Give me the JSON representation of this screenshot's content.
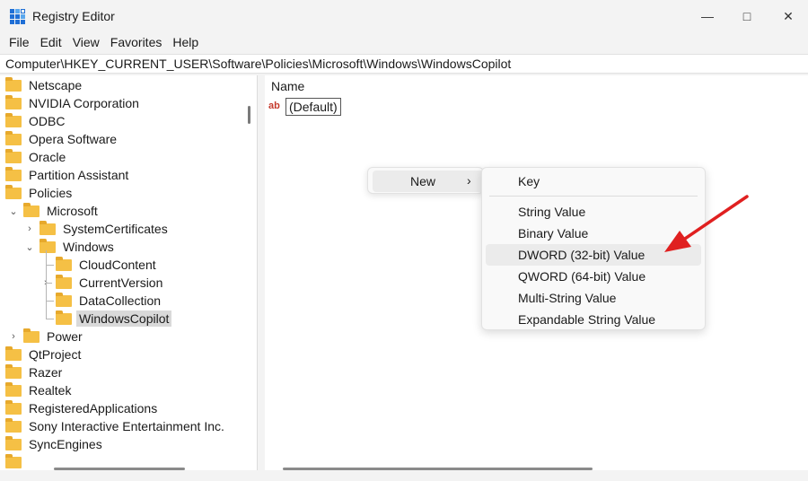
{
  "window": {
    "title": "Registry Editor"
  },
  "menu": [
    "File",
    "Edit",
    "View",
    "Favorites",
    "Help"
  ],
  "address": "Computer\\HKEY_CURRENT_USER\\Software\\Policies\\Microsoft\\Windows\\WindowsCopilot",
  "tree": [
    {
      "label": "Netscape",
      "chevron": ""
    },
    {
      "label": "NVIDIA Corporation",
      "chevron": ""
    },
    {
      "label": "ODBC",
      "chevron": ""
    },
    {
      "label": "Opera Software",
      "chevron": ""
    },
    {
      "label": "Oracle",
      "chevron": ""
    },
    {
      "label": "Partition Assistant",
      "chevron": ""
    },
    {
      "label": "Policies",
      "chevron": ""
    },
    {
      "label": "Microsoft",
      "chevron": "⌄"
    },
    {
      "label": "SystemCertificates",
      "chevron": "›"
    },
    {
      "label": "Windows",
      "chevron": "⌄"
    },
    {
      "label": "CloudContent",
      "chevron": ""
    },
    {
      "label": "CurrentVersion",
      "chevron": "›"
    },
    {
      "label": "DataCollection",
      "chevron": ""
    },
    {
      "label": "WindowsCopilot",
      "chevron": ""
    },
    {
      "label": "Power",
      "chevron": "›"
    },
    {
      "label": "QtProject",
      "chevron": ""
    },
    {
      "label": "Razer",
      "chevron": ""
    },
    {
      "label": "Realtek",
      "chevron": ""
    },
    {
      "label": "RegisteredApplications",
      "chevron": ""
    },
    {
      "label": "Sony Interactive Entertainment Inc.",
      "chevron": ""
    },
    {
      "label": "SyncEngines",
      "chevron": ""
    }
  ],
  "values_pane": {
    "column_name": "Name",
    "entries": [
      {
        "icon": "ab",
        "name": "(Default)"
      }
    ]
  },
  "context_menu": {
    "new_label": "New",
    "arrow": "›"
  },
  "submenu": [
    "Key",
    "String Value",
    "Binary Value",
    "DWORD (32-bit) Value",
    "QWORD (64-bit) Value",
    "Multi-String Value",
    "Expandable String Value"
  ],
  "colors": {
    "folder": "#f5c045",
    "arrow": "#e02020",
    "selection": "#d9d9d9"
  }
}
